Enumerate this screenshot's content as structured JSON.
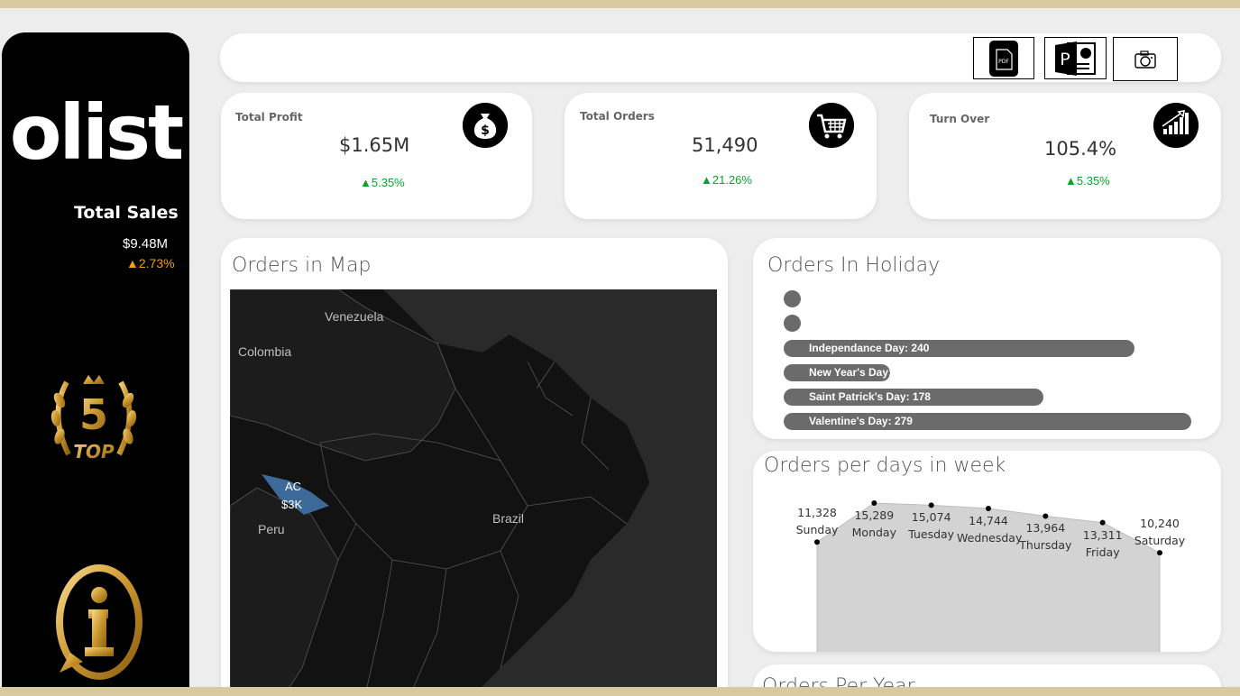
{
  "sidebar": {
    "logo_text": "olist",
    "total_sales_title": "Total Sales",
    "total_sales_value": "$9.48M",
    "total_sales_delta": "▲2.73%",
    "top5_number": "5",
    "top5_text": "TOP"
  },
  "toolbar": {
    "pdf_label": "PDF",
    "ppt_label": "P"
  },
  "kpis": [
    {
      "label": "Total Profit",
      "value": "$1.65M",
      "delta": "▲5.35%",
      "icon": "money-bag-icon"
    },
    {
      "label": "Total Orders",
      "value": "51,490",
      "delta": "▲21.26%",
      "icon": "shopping-cart-icon"
    },
    {
      "label": "Turn Over",
      "value": "105.4%",
      "delta": "▲5.35%",
      "icon": "bar-growth-icon"
    }
  ],
  "map_panel": {
    "title": "Orders in Map",
    "labels": [
      "Venezuela",
      "Colombia",
      "Peru",
      "Brazil"
    ],
    "highlight_state": "AC",
    "highlight_value": "$3K"
  },
  "holiday_panel": {
    "title": "Orders In Holiday",
    "bars": [
      {
        "label": "Independance Day: 240",
        "value": 240
      },
      {
        "label": "New Year's Day:",
        "value": 73
      },
      {
        "label": "Saint Patrick's Day: 178",
        "value": 178
      },
      {
        "label": "Valentine's Day: 279",
        "value": 279
      }
    ]
  },
  "chart_data": {
    "type": "area",
    "title": "Orders per days in week",
    "categories": [
      "Sunday",
      "Monday",
      "Tuesday",
      "Wednesday",
      "Thursday",
      "Friday",
      "Saturday"
    ],
    "values": [
      11328,
      15289,
      15074,
      14744,
      13964,
      13311,
      10240
    ],
    "value_labels": [
      "11,328",
      "15,289",
      "15,074",
      "14,744",
      "13,964",
      "13,311",
      "10,240"
    ],
    "color": "#d3d3d3"
  },
  "year_panel": {
    "title": "Orders Per Year"
  },
  "colors": {
    "accent_green": "#0aa32b",
    "accent_orange": "#f2a007",
    "map_highlight": "#3e6a9a"
  }
}
